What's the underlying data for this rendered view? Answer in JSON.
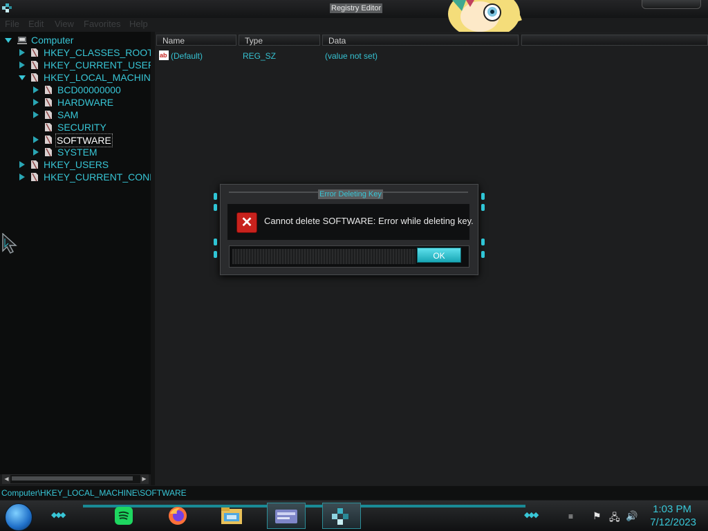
{
  "window": {
    "title": "Registry Editor",
    "menu": [
      "File",
      "Edit",
      "View",
      "Favorites",
      "Help"
    ]
  },
  "tree": {
    "items": [
      {
        "label": "Computer"
      },
      {
        "label": "HKEY_CLASSES_ROOT"
      },
      {
        "label": "HKEY_CURRENT_USER"
      },
      {
        "label": "HKEY_LOCAL_MACHINE"
      },
      {
        "label": "BCD00000000"
      },
      {
        "label": "HARDWARE"
      },
      {
        "label": "SAM"
      },
      {
        "label": "SECURITY"
      },
      {
        "label": "SOFTWARE"
      },
      {
        "label": "SYSTEM"
      },
      {
        "label": "HKEY_USERS"
      },
      {
        "label": "HKEY_CURRENT_CONFI"
      }
    ]
  },
  "list": {
    "columns": [
      "Name",
      "Type",
      "Data"
    ],
    "rows": [
      {
        "name": "(Default)",
        "type": "REG_SZ",
        "data": "(value not set)"
      }
    ]
  },
  "statusbar": {
    "path": "Computer\\HKEY_LOCAL_MACHINE\\SOFTWARE"
  },
  "dialog": {
    "title": "Error Deleting Key",
    "message": "Cannot delete SOFTWARE:  Error while deleting key.",
    "ok_label": "OK"
  },
  "taskbar": {
    "apps": [
      "Spotify",
      "Firefox",
      "File Explorer",
      "Control Panel",
      "Registry Editor"
    ],
    "time": "1:03 PM",
    "date": "7/12/2023"
  },
  "colors": {
    "accent": "#38c6d6",
    "background": "#1b1c1d",
    "tree_background": "#0c0d0d",
    "error_icon": "#c8221d"
  }
}
